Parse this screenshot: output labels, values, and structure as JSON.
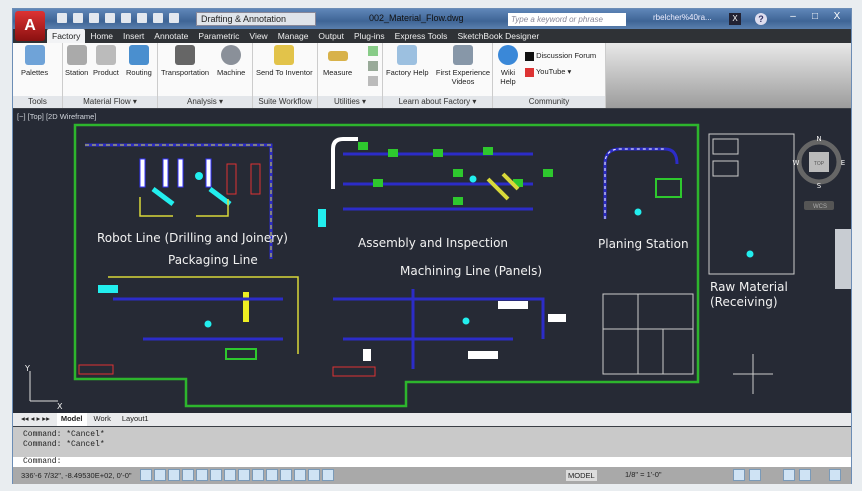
{
  "title_bar": {
    "app_logo": "A",
    "workspace": "Drafting & Annotation",
    "file_name": "002_Material_Flow.dwg",
    "search_placeholder": "Type a keyword or phrase",
    "user": "rbelcher%40ra...",
    "window_controls": [
      "–",
      "□",
      "X"
    ]
  },
  "ribbon_tabs": [
    "Factory",
    "Home",
    "Insert",
    "Annotate",
    "Parametric",
    "View",
    "Manage",
    "Output",
    "Plug-ins",
    "Express Tools",
    "SketchBook Designer"
  ],
  "panels": {
    "tools": {
      "label": "Tools",
      "buttons": [
        "Palettes"
      ]
    },
    "material_flow": {
      "label": "Material Flow ▾",
      "buttons": [
        "Station",
        "Product",
        "Routing"
      ]
    },
    "analysis": {
      "label": "Analysis ▾",
      "buttons": [
        "Transportation",
        "Machine"
      ]
    },
    "suite_workflow": {
      "label": "Suite Workflow",
      "buttons": [
        "Send To Inventor"
      ]
    },
    "utilities": {
      "label": "Utilities ▾",
      "buttons": [
        "Measure"
      ]
    },
    "learn": {
      "label": "Learn about Factory ▾",
      "buttons": [
        "Factory Help",
        "First Experience Videos"
      ]
    },
    "community": {
      "label": "Community",
      "buttons": [
        "Wiki Help",
        "Discussion Forum",
        "YouTube ▾"
      ]
    }
  },
  "viewport": {
    "label": "[−] [Top] [2D Wireframe]",
    "viewcube": {
      "n": "N",
      "s": "S",
      "e": "E",
      "w": "W",
      "face": "TOP",
      "wcs": "WCS"
    },
    "areas": [
      "Robot Line (Drilling and Joinery)",
      "Packaging Line",
      "Assembly and Inspection",
      "Planing Station",
      "Machining Line (Panels)",
      "Raw Material",
      "(Receiving)"
    ],
    "ucs": {
      "y": "Y",
      "x": "X"
    }
  },
  "layout_tabs": [
    "Model",
    "Work",
    "Layout1"
  ],
  "command": {
    "history": [
      "Command: *Cancel*",
      "Command: *Cancel*"
    ],
    "prompt": "Command:"
  },
  "status": {
    "coords": "336'-6 7/32\", -8.49530E+02, 0'-0\"",
    "model": "MODEL",
    "scale": "1/8\" = 1'-0\""
  }
}
